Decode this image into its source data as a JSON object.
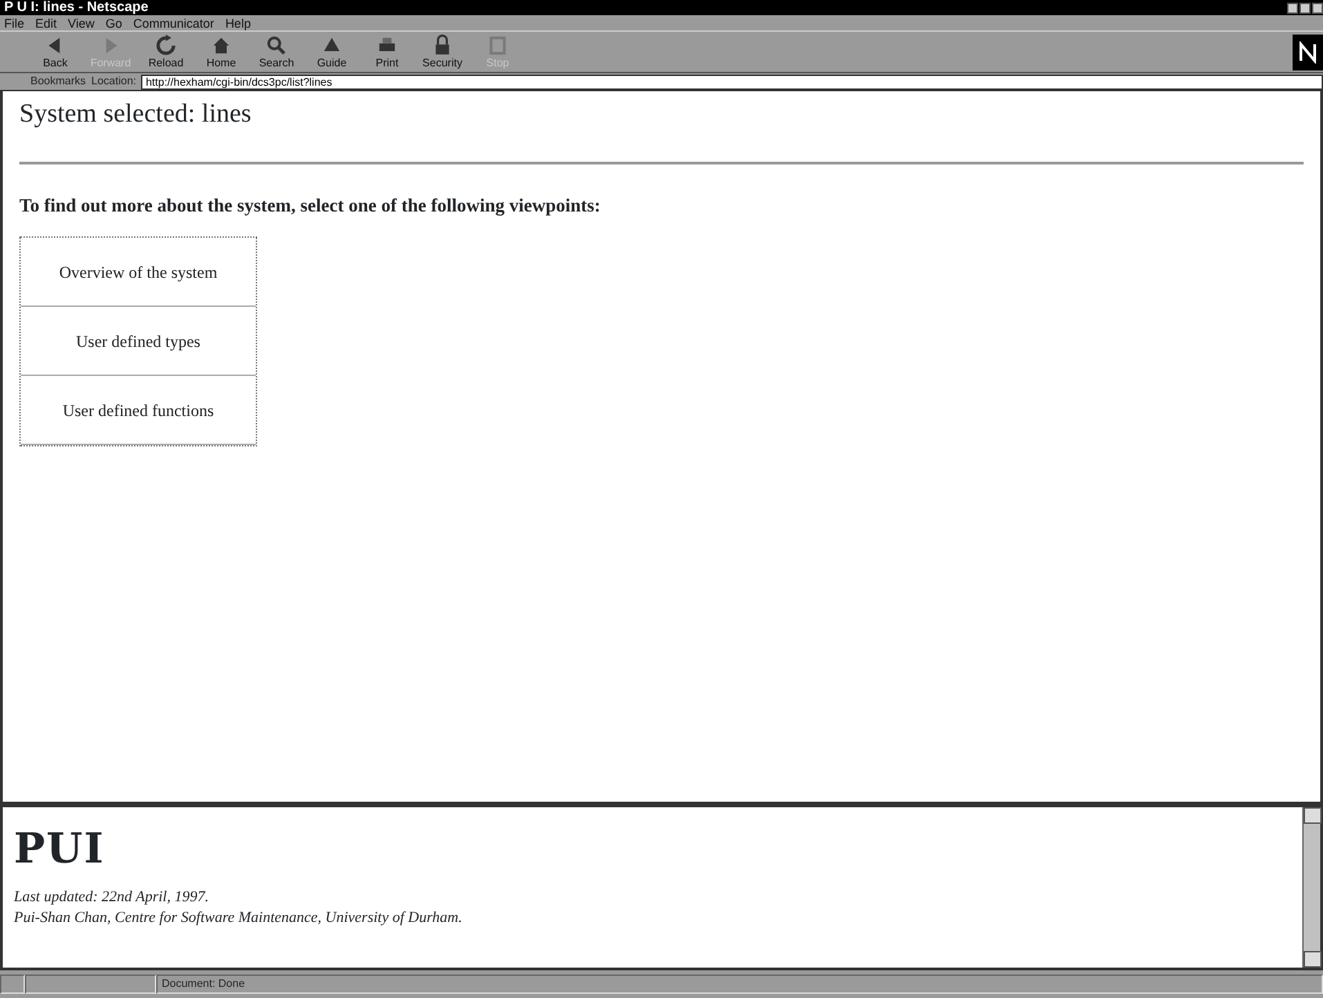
{
  "window": {
    "title": "P U I: lines - Netscape"
  },
  "menu": [
    "File",
    "Edit",
    "View",
    "Go",
    "Communicator",
    "Help"
  ],
  "toolbar": [
    {
      "label": "Back",
      "disabled": false
    },
    {
      "label": "Forward",
      "disabled": true
    },
    {
      "label": "Reload",
      "disabled": false
    },
    {
      "label": "Home",
      "disabled": false
    },
    {
      "label": "Search",
      "disabled": false
    },
    {
      "label": "Guide",
      "disabled": false
    },
    {
      "label": "Print",
      "disabled": false
    },
    {
      "label": "Security",
      "disabled": false
    },
    {
      "label": "Stop",
      "disabled": true
    }
  ],
  "location_bar": {
    "bookmarks": "Bookmarks",
    "location_label": "Location:",
    "url": "http://hexham/cgi-bin/dcs3pc/list?lines"
  },
  "top_frame": {
    "heading": "System selected: lines",
    "prompt": "To find out more about the system, select one of the following viewpoints:",
    "viewpoints": [
      "Overview of the system",
      "User defined types",
      "User defined functions"
    ]
  },
  "bottom_frame": {
    "logo": "PUI",
    "updated": "Last updated: 22nd April, 1997.",
    "author": "Pui-Shan Chan, Centre for Software Maintenance, University of Durham."
  },
  "status_bar": {
    "text": "Document: Done"
  }
}
